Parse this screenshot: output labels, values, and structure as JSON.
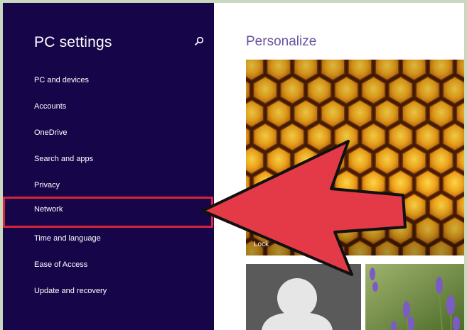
{
  "sidebar": {
    "title": "PC settings",
    "items": [
      {
        "label": "PC and devices"
      },
      {
        "label": "Accounts"
      },
      {
        "label": "OneDrive"
      },
      {
        "label": "Search and apps"
      },
      {
        "label": "Privacy"
      },
      {
        "label": "Network"
      },
      {
        "label": "Time and language"
      },
      {
        "label": "Ease of Access"
      },
      {
        "label": "Update and recovery"
      }
    ],
    "active_item": "Network"
  },
  "main": {
    "title": "Personalize",
    "lock_screen_label": "Lock"
  },
  "icons": {
    "search": "search-icon",
    "annotation": "red-arrow-annotation"
  },
  "colors": {
    "sidebar_bg": "#17054a",
    "accent_title": "#6a53a0",
    "highlight": "#d9253a",
    "arrow": "#e43a47"
  }
}
